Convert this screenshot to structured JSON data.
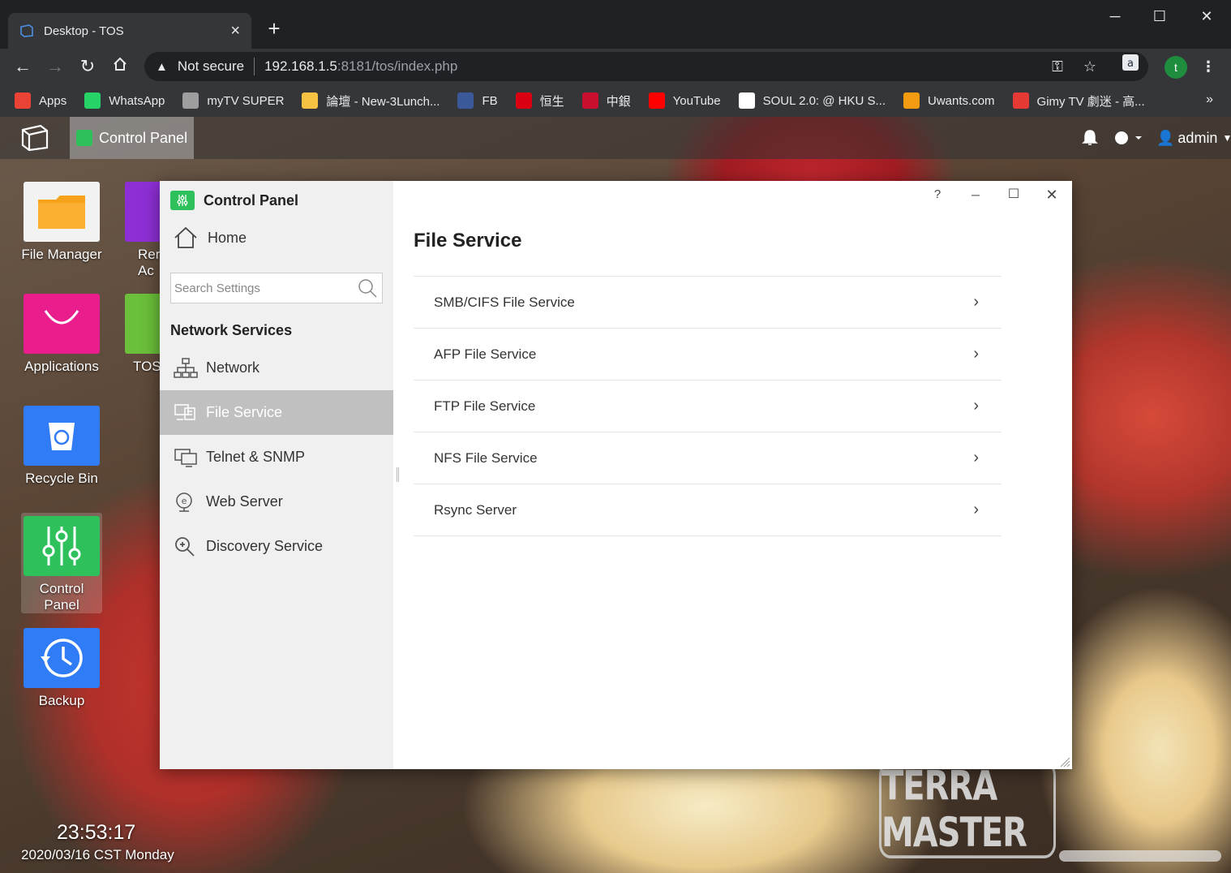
{
  "browser": {
    "tab_title": "Desktop - TOS",
    "new_tab": "+",
    "win_min": "─",
    "win_max": "☐",
    "win_close": "✕",
    "security_label": "Not secure",
    "url_host": "192.168.1.5",
    "url_path": ":8181/tos/index.php",
    "profile_initial": "t",
    "bookmarks": [
      {
        "label": "Apps",
        "icon": "apps-grid-icon",
        "color": "#ea4335"
      },
      {
        "label": "WhatsApp",
        "icon": "whatsapp-icon",
        "color": "#25d366"
      },
      {
        "label": "myTV SUPER",
        "icon": "mytv-icon",
        "color": "#9e9e9e"
      },
      {
        "label": "論壇 - New-3Lunch...",
        "icon": "forum-icon",
        "color": "#f5c242"
      },
      {
        "label": "FB",
        "icon": "facebook-icon",
        "color": "#3b5998"
      },
      {
        "label": "恒生",
        "icon": "hangseng-icon",
        "color": "#db0011"
      },
      {
        "label": "中銀",
        "icon": "boc-icon",
        "color": "#c8102e"
      },
      {
        "label": "YouTube",
        "icon": "youtube-icon",
        "color": "#ff0000"
      },
      {
        "label": "SOUL 2.0: @ HKU S...",
        "icon": "blank-page-icon",
        "color": "#ffffff"
      },
      {
        "label": "Uwants.com",
        "icon": "uwants-icon",
        "color": "#f39c12"
      },
      {
        "label": "Gimy TV 劇迷 - 高...",
        "icon": "gimy-icon",
        "color": "#e53935"
      }
    ],
    "more_bookmarks": "»"
  },
  "tos": {
    "taskbar_app": "Control Panel",
    "user": "admin",
    "desktop_icons": [
      {
        "label": "File Manager",
        "color": "#f5f5f5"
      },
      {
        "label": "Applications",
        "color": "#e91e8c"
      },
      {
        "label": "Recycle Bin",
        "color": "#2f7cf6"
      },
      {
        "label": "Control Panel",
        "color": "#2ec05a"
      },
      {
        "label": "Backup",
        "color": "#2f7cf6"
      },
      {
        "label": "Rer Ac",
        "color": "#8e2fd6"
      },
      {
        "label": "TOS",
        "color": "#6bbf3a"
      }
    ],
    "clock": "23:53:17",
    "date": "2020/03/16 CST Monday",
    "brand": "TERRA MASTER"
  },
  "control_panel": {
    "title": "Control Panel",
    "home": "Home",
    "search_placeholder": "Search Settings",
    "section": "Network Services",
    "nav": [
      {
        "label": "Network",
        "icon": "network-icon"
      },
      {
        "label": "File Service",
        "icon": "file-service-icon",
        "selected": true
      },
      {
        "label": "Telnet & SNMP",
        "icon": "monitor-icon"
      },
      {
        "label": "Web Server",
        "icon": "web-server-icon"
      },
      {
        "label": "Discovery Service",
        "icon": "discovery-icon"
      }
    ],
    "window_buttons": {
      "help": "?",
      "minimize": "─",
      "maximize": "☐",
      "close": "✕"
    },
    "page_title": "File Service",
    "services": [
      {
        "label": "SMB/CIFS File Service"
      },
      {
        "label": "AFP File Service"
      },
      {
        "label": "FTP File Service"
      },
      {
        "label": "NFS File Service"
      },
      {
        "label": "Rsync Server"
      }
    ]
  },
  "colors": {
    "accent_green": "#2ec05a",
    "selected_nav": "#c0c0c0"
  }
}
